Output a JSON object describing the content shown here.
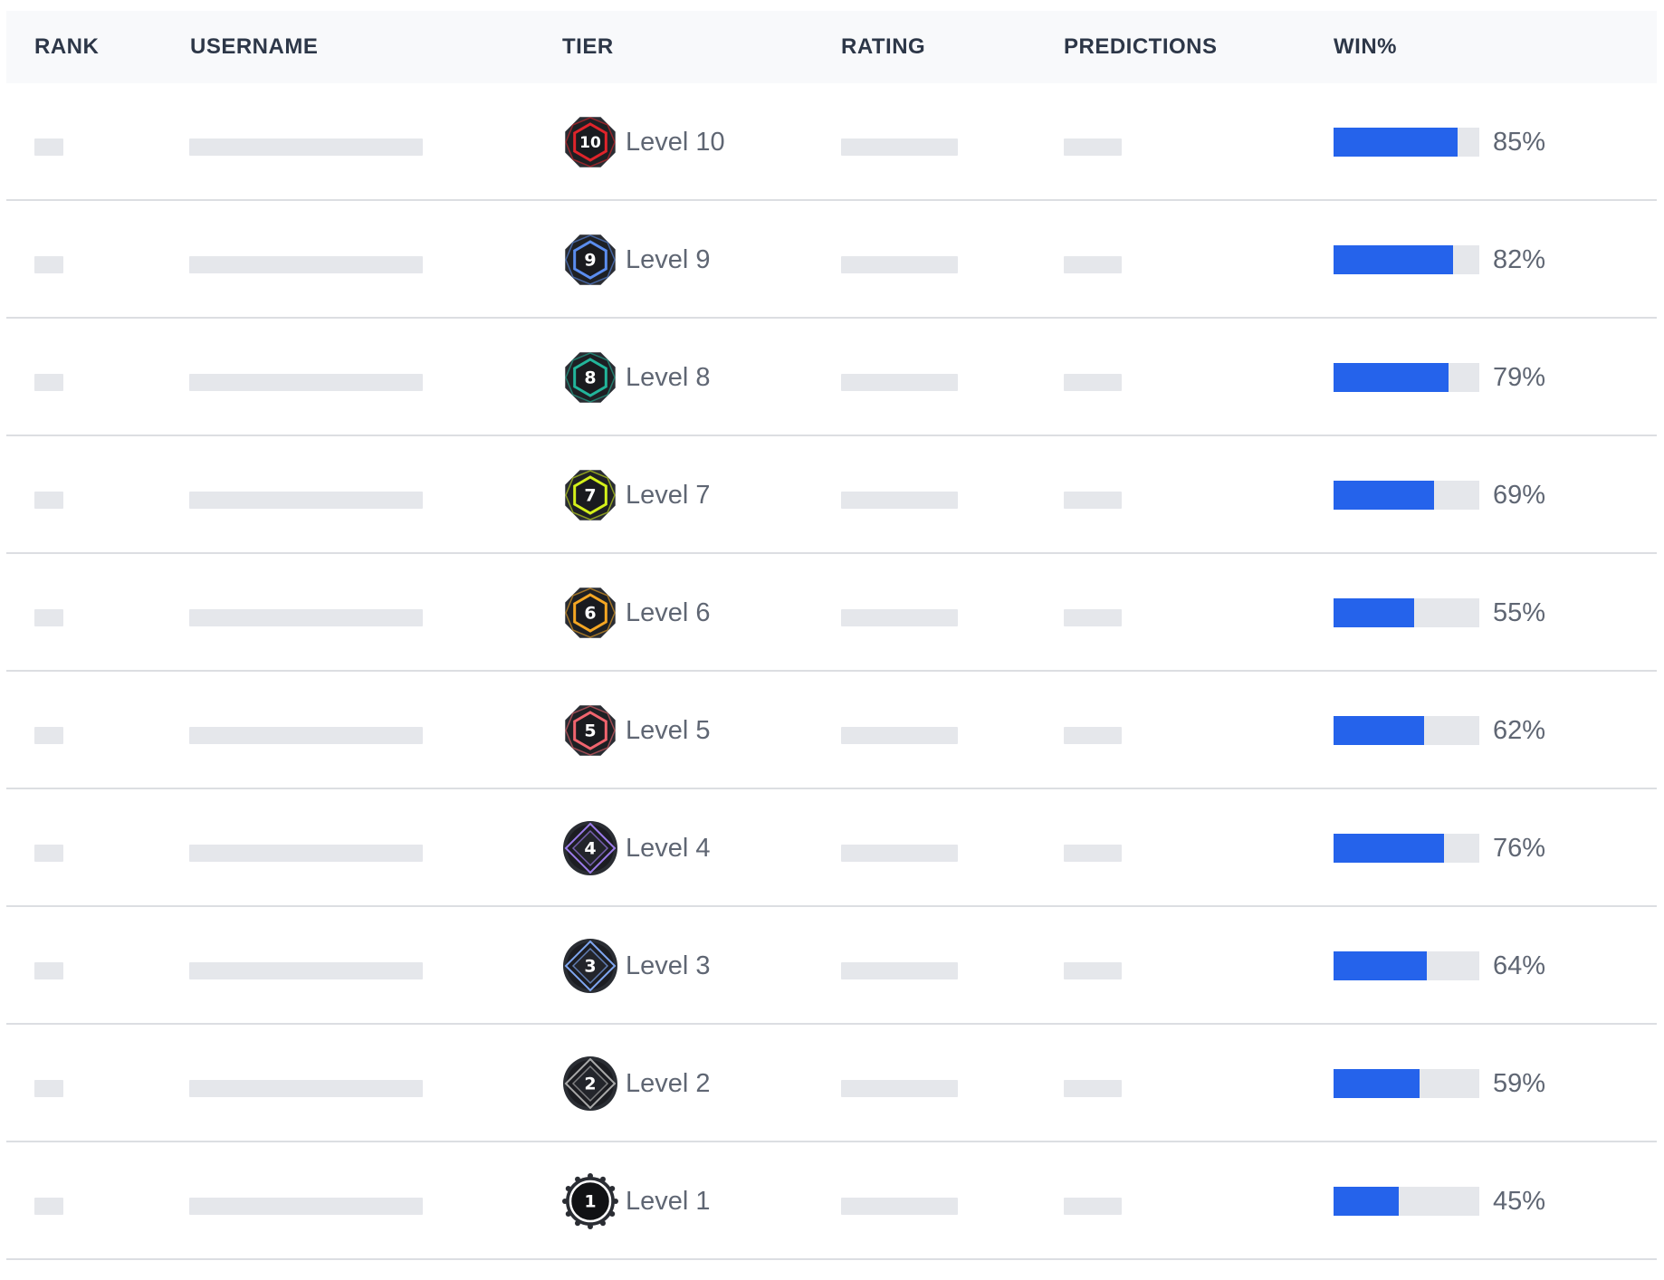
{
  "columns": {
    "rank": "RANK",
    "username": "USERNAME",
    "tier": "TIER",
    "rating": "RATING",
    "predictions": "PREDICTIONS",
    "win": "WIN%"
  },
  "colors": {
    "bar_fill": "#2563eb",
    "bar_track": "#e5e7eb",
    "skeleton": "#e5e7eb"
  },
  "rows": [
    {
      "level": "10",
      "label": "Level 10",
      "win": 85,
      "win_text": "85%",
      "badge_color": "#e0242b",
      "badge_shape": "octagon"
    },
    {
      "level": "9",
      "label": "Level 9",
      "win": 82,
      "win_text": "82%",
      "badge_color": "#5b8def",
      "badge_shape": "octagon"
    },
    {
      "level": "8",
      "label": "Level 8",
      "win": 79,
      "win_text": "79%",
      "badge_color": "#22b59a",
      "badge_shape": "octagon"
    },
    {
      "level": "7",
      "label": "Level 7",
      "win": 69,
      "win_text": "69%",
      "badge_color": "#d4f01a",
      "badge_shape": "octagon"
    },
    {
      "level": "6",
      "label": "Level 6",
      "win": 55,
      "win_text": "55%",
      "badge_color": "#f5a623",
      "badge_shape": "octagon"
    },
    {
      "level": "5",
      "label": "Level 5",
      "win": 62,
      "win_text": "62%",
      "badge_color": "#f0646e",
      "badge_shape": "octagon"
    },
    {
      "level": "4",
      "label": "Level 4",
      "win": 76,
      "win_text": "76%",
      "badge_color": "#9b7bea",
      "badge_shape": "diamond"
    },
    {
      "level": "3",
      "label": "Level 3",
      "win": 64,
      "win_text": "64%",
      "badge_color": "#7fa6f0",
      "badge_shape": "diamond"
    },
    {
      "level": "2",
      "label": "Level 2",
      "win": 59,
      "win_text": "59%",
      "badge_color": "#a8a8a8",
      "badge_shape": "diamond"
    },
    {
      "level": "1",
      "label": "Level 1",
      "win": 45,
      "win_text": "45%",
      "badge_color": "#ffffff",
      "badge_shape": "circle"
    }
  ]
}
